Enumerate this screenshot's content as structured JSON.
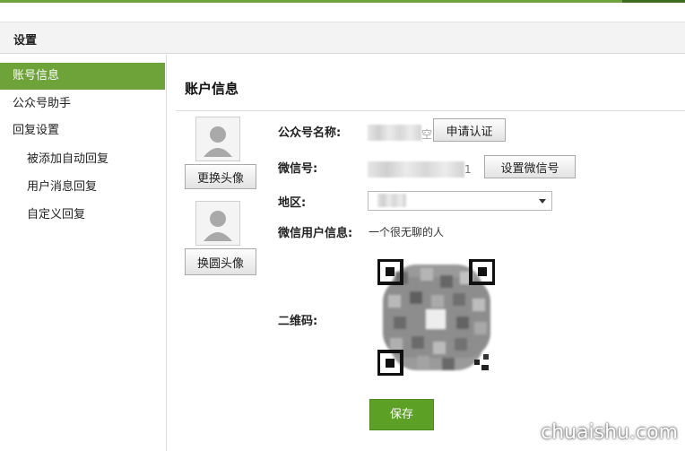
{
  "header": {
    "title": "设置"
  },
  "sidebar": {
    "items": [
      {
        "label": "账号信息"
      },
      {
        "label": "公众号助手"
      },
      {
        "label": "回复设置"
      },
      {
        "label": "被添加自动回复"
      },
      {
        "label": "用户消息回复"
      },
      {
        "label": "自定义回复"
      }
    ]
  },
  "main": {
    "title": "账户信息",
    "avatar": {
      "change_label": "更换头像"
    },
    "round_avatar": {
      "change_label": "换圆头像"
    },
    "fields": {
      "name_label": "公众号名称:",
      "name_suffix": "空",
      "apply_verify_label": "申请认证",
      "wechat_id_label": "微信号:",
      "wechat_id_suffix": "1",
      "set_wechat_id_label": "设置微信号",
      "region_label": "地区:",
      "user_info_label": "微信用户信息:",
      "user_info_value": "一个很无聊的人",
      "qrcode_label": "二维码:"
    },
    "save_label": "保存"
  },
  "watermark": "chuaishu.com",
  "colors": {
    "accent": "#6ea339",
    "save": "#5da026"
  }
}
